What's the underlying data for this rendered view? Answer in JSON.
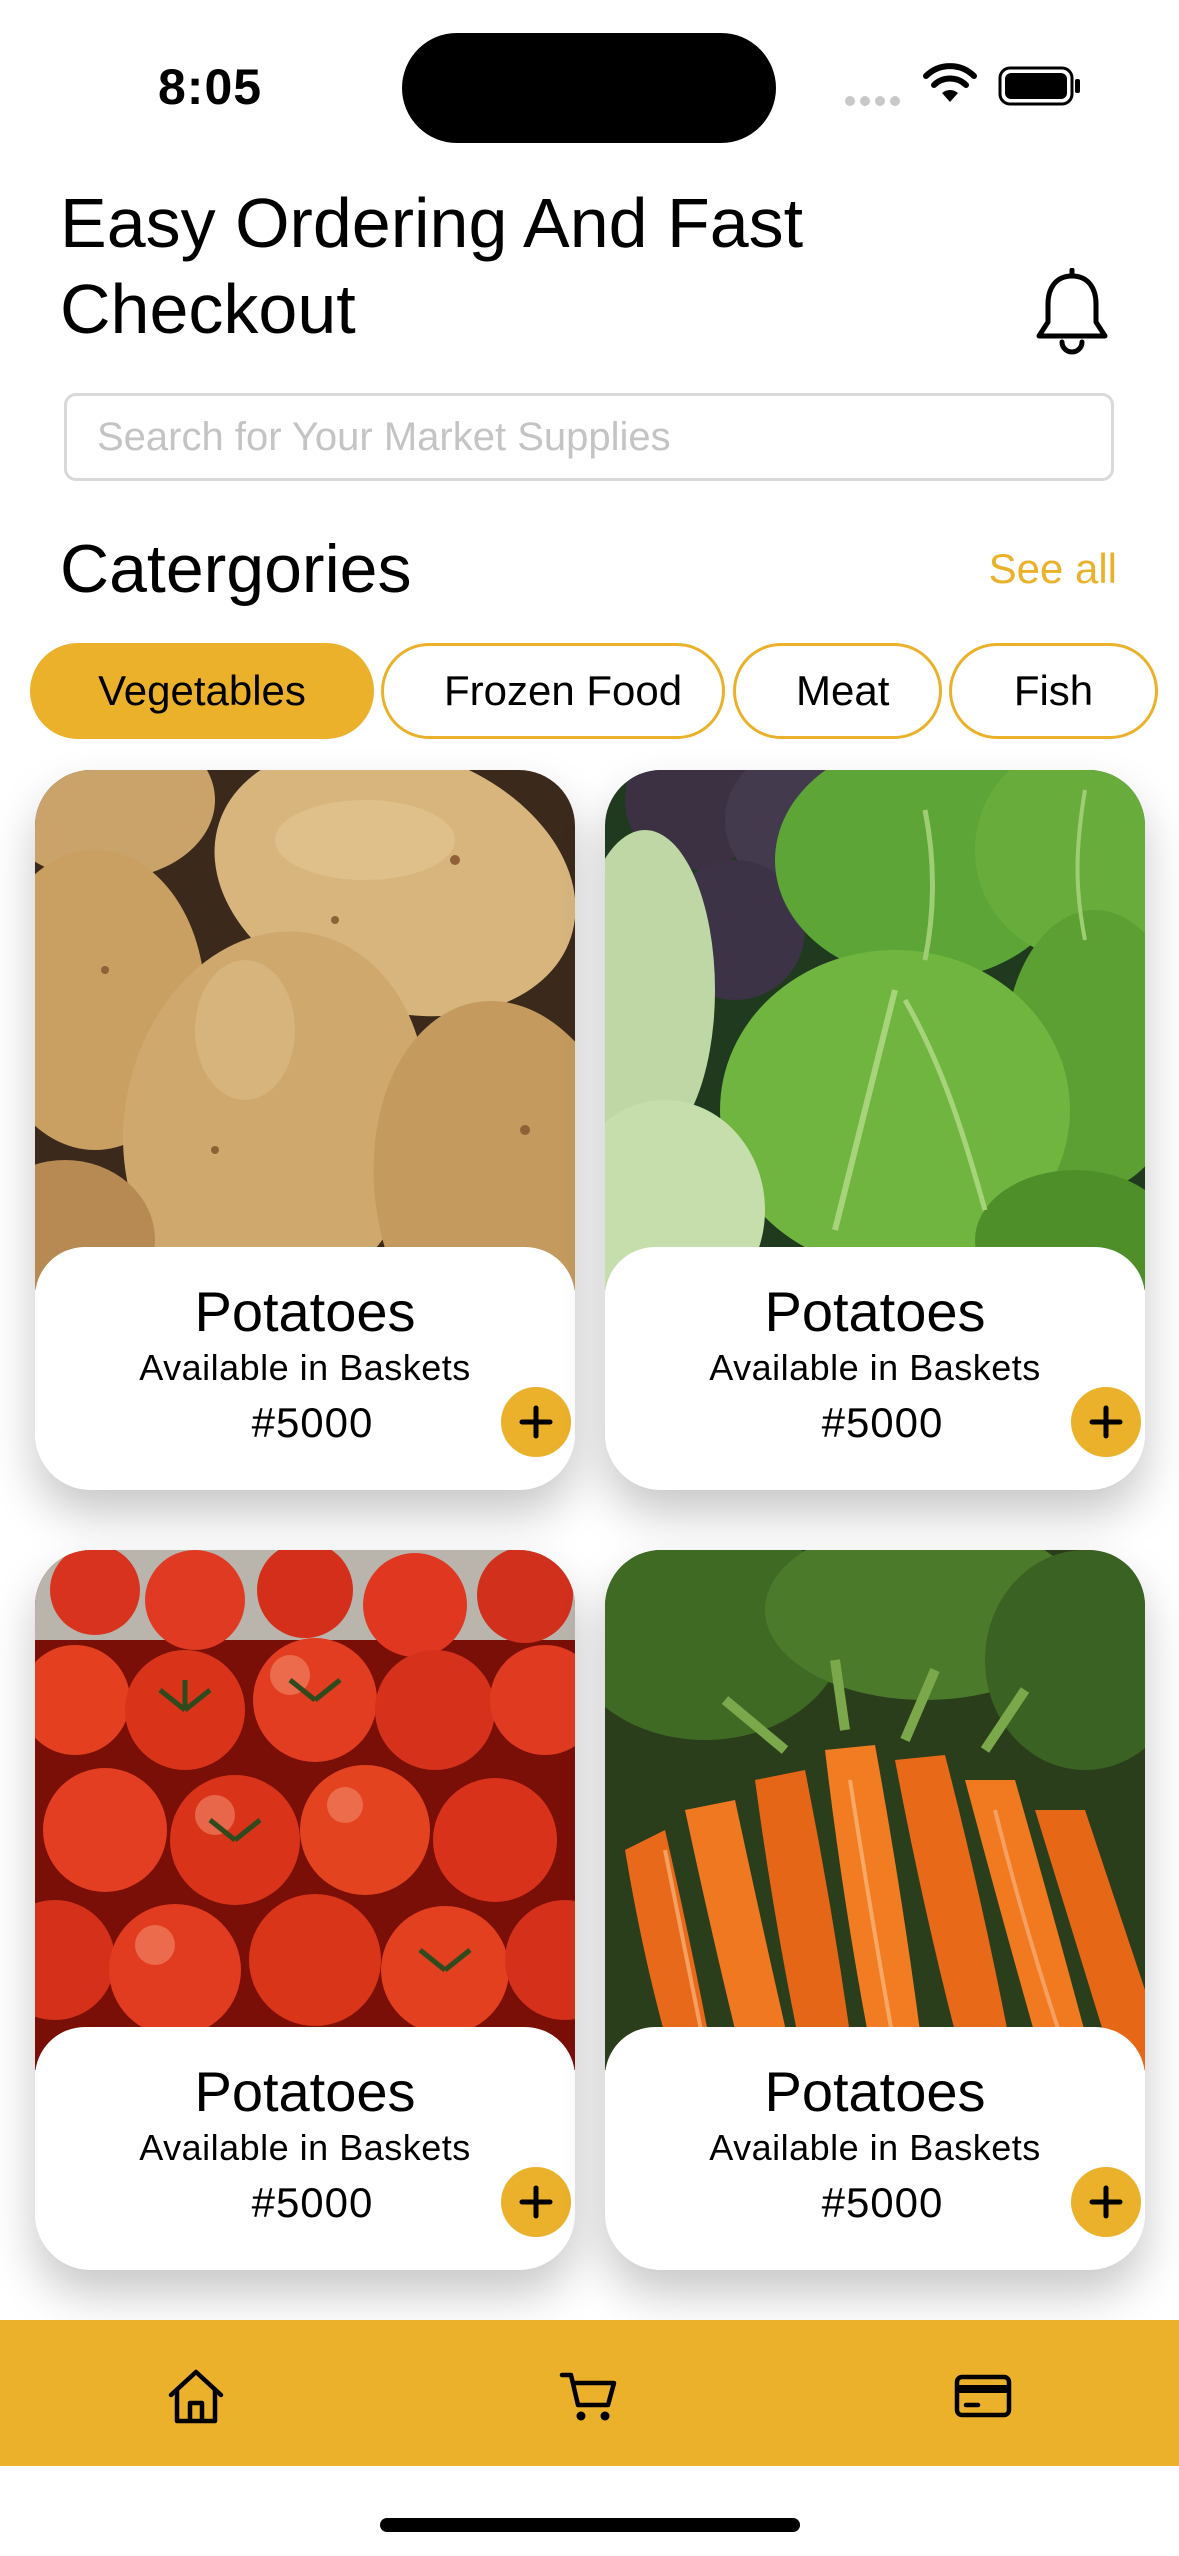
{
  "status_bar": {
    "time": "8:05"
  },
  "header": {
    "title": "Easy Ordering And Fast Checkout",
    "notification_icon": "bell-icon"
  },
  "search": {
    "placeholder": "Search for Your Market Supplies",
    "value": ""
  },
  "categories": {
    "title": "Catergories",
    "see_all": "See all",
    "items": [
      {
        "label": "Vegetables",
        "active": true
      },
      {
        "label": "Frozen Food",
        "active": false
      },
      {
        "label": "Meat",
        "active": false
      },
      {
        "label": "Fish",
        "active": false
      }
    ]
  },
  "products": [
    {
      "name": "Potatoes",
      "availability": "Available in Baskets",
      "price": "#5000",
      "image": "potatoes"
    },
    {
      "name": "Potatoes",
      "availability": "Available in Baskets",
      "price": "#5000",
      "image": "cabbage"
    },
    {
      "name": "Potatoes",
      "availability": "Available in Baskets",
      "price": "#5000",
      "image": "tomatoes"
    },
    {
      "name": "Potatoes",
      "availability": "Available in Baskets",
      "price": "#5000",
      "image": "carrots"
    }
  ],
  "bottom_nav": {
    "items": [
      {
        "icon": "home-icon"
      },
      {
        "icon": "cart-icon"
      },
      {
        "icon": "card-icon"
      }
    ]
  },
  "colors": {
    "accent": "#ebb12a",
    "text": "#000000",
    "placeholder": "#c4c4c4",
    "search_border": "#d9d9d9"
  }
}
